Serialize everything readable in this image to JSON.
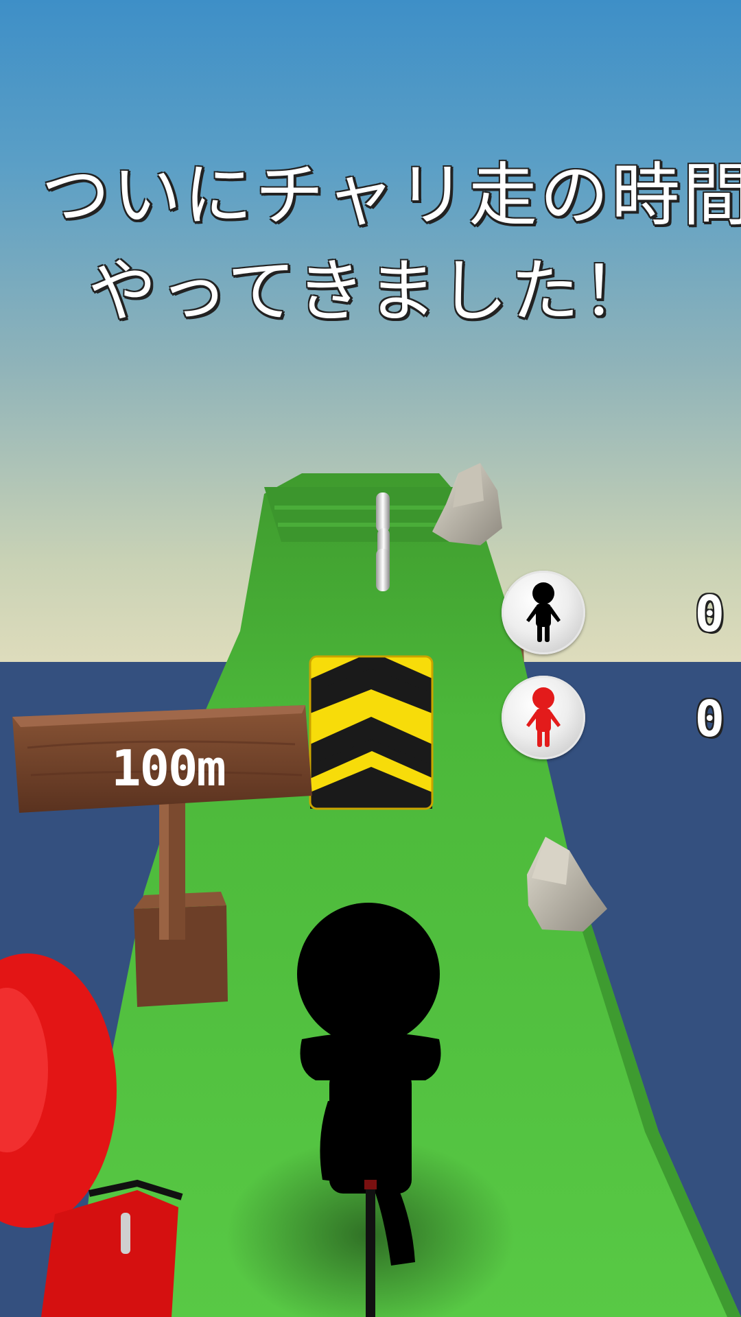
{
  "announcement": {
    "line1": "ついにチャリ走の時間が",
    "line2": "やってきました！"
  },
  "signpost": {
    "distance": "100m"
  },
  "players": [
    {
      "name": "black-runner",
      "color": "#000000",
      "score": "0"
    },
    {
      "name": "red-runner",
      "color": "#e31b1b",
      "score": "0"
    }
  ],
  "colors": {
    "sky_top": "#3e8fc7",
    "sky_horizon": "#dedcbc",
    "sea": "#34507f",
    "grass": "#4fbf3c",
    "hazard_yellow": "#f7e10a",
    "hazard_black": "#1a1a1a",
    "wood": "#6b3f2a"
  },
  "icons": [
    "stickman-black-icon",
    "stickman-red-icon",
    "coin-icon",
    "rock-icon"
  ]
}
